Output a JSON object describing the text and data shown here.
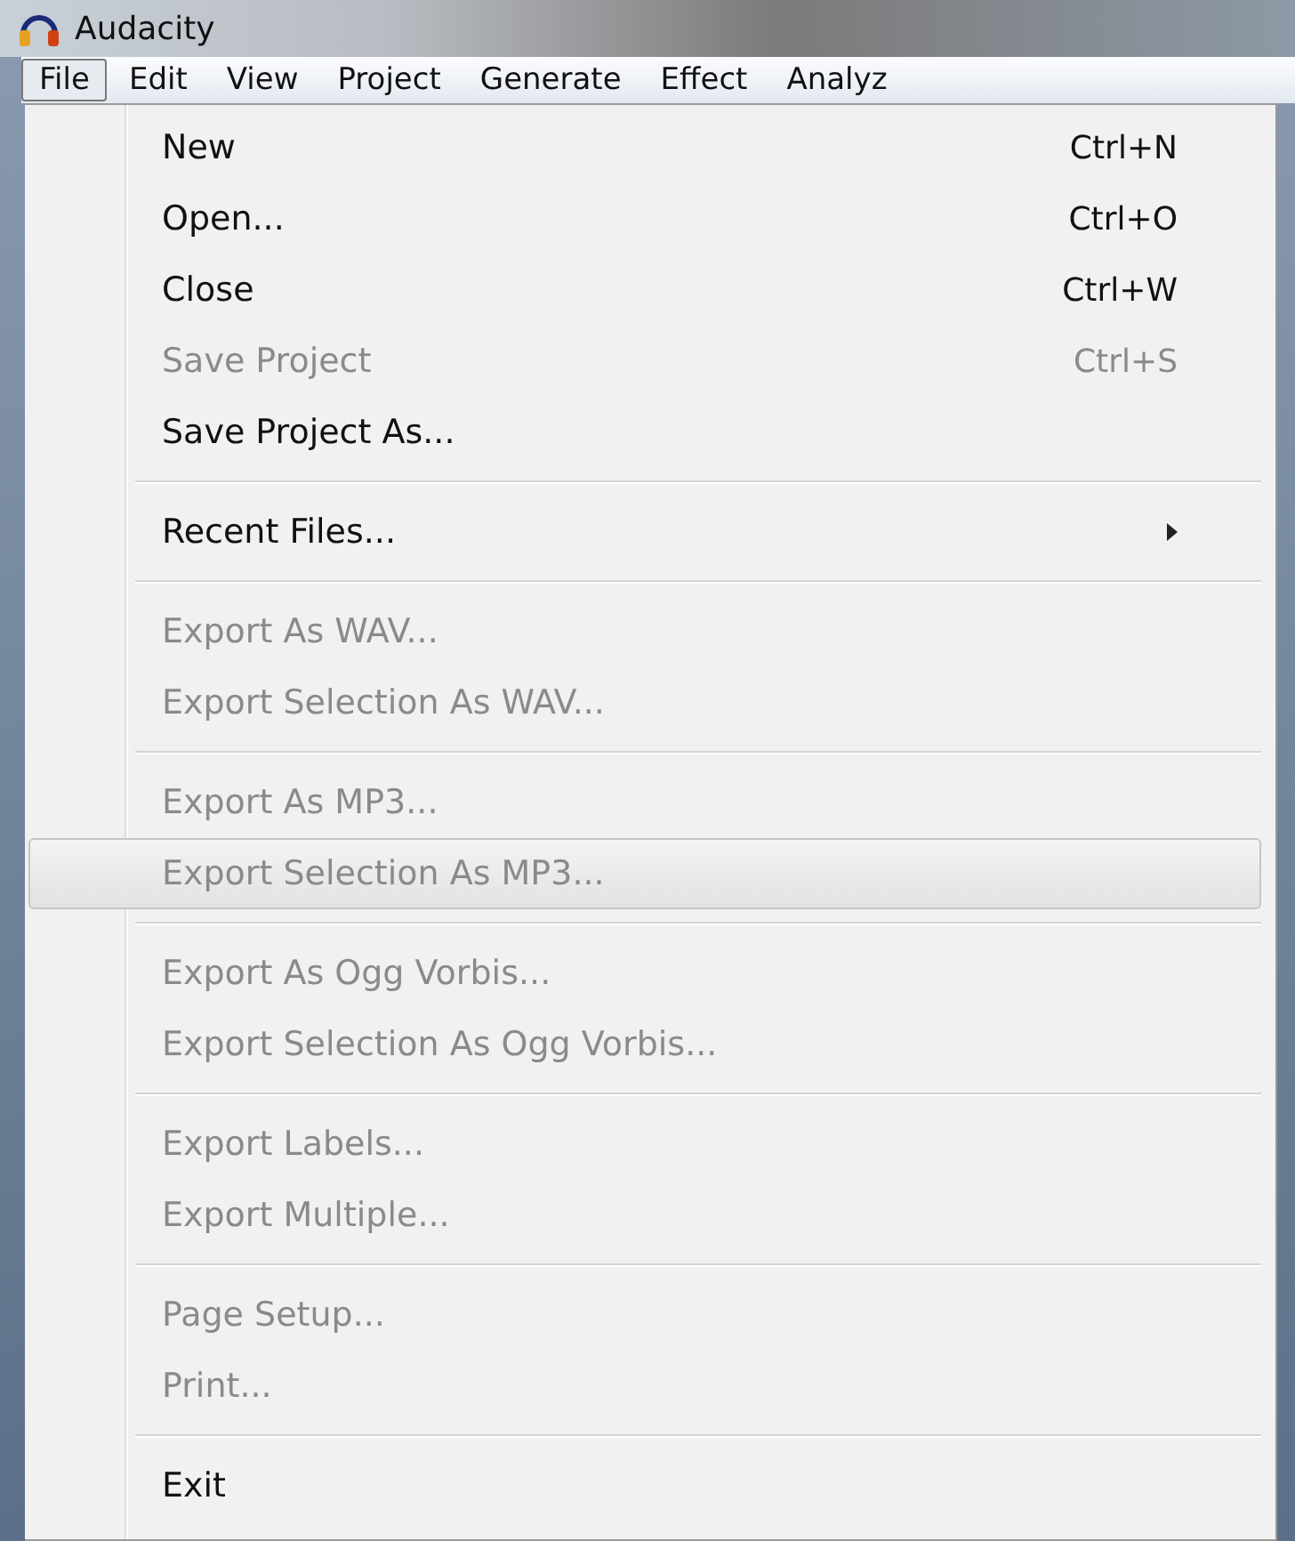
{
  "window": {
    "title": "Audacity"
  },
  "menu_bar": [
    {
      "label": "File",
      "selected": true
    },
    {
      "label": "Edit",
      "selected": false
    },
    {
      "label": "View",
      "selected": false
    },
    {
      "label": "Project",
      "selected": false
    },
    {
      "label": "Generate",
      "selected": false
    },
    {
      "label": "Effect",
      "selected": false
    },
    {
      "label": "Analyz",
      "selected": false
    }
  ],
  "file_menu": [
    {
      "kind": "item",
      "label": "New",
      "shortcut": "Ctrl+N",
      "disabled": false,
      "selected": false
    },
    {
      "kind": "item",
      "label": "Open...",
      "shortcut": "Ctrl+O",
      "disabled": false,
      "selected": false
    },
    {
      "kind": "item",
      "label": "Close",
      "shortcut": "Ctrl+W",
      "disabled": false,
      "selected": false
    },
    {
      "kind": "item",
      "label": "Save Project",
      "shortcut": "Ctrl+S",
      "disabled": true,
      "selected": false
    },
    {
      "kind": "item",
      "label": "Save Project As...",
      "disabled": false,
      "selected": false
    },
    {
      "kind": "separator"
    },
    {
      "kind": "submenu",
      "label": "Recent Files...",
      "disabled": false,
      "selected": false
    },
    {
      "kind": "separator"
    },
    {
      "kind": "item",
      "label": "Export As WAV...",
      "disabled": true,
      "selected": false
    },
    {
      "kind": "item",
      "label": "Export Selection As WAV...",
      "disabled": true,
      "selected": false
    },
    {
      "kind": "separator"
    },
    {
      "kind": "item",
      "label": "Export As MP3...",
      "disabled": true,
      "selected": false
    },
    {
      "kind": "item",
      "label": "Export Selection As MP3...",
      "disabled": true,
      "selected": true
    },
    {
      "kind": "separator"
    },
    {
      "kind": "item",
      "label": "Export As Ogg Vorbis...",
      "disabled": true,
      "selected": false
    },
    {
      "kind": "item",
      "label": "Export Selection As Ogg Vorbis...",
      "disabled": true,
      "selected": false
    },
    {
      "kind": "separator"
    },
    {
      "kind": "item",
      "label": "Export Labels...",
      "disabled": true,
      "selected": false
    },
    {
      "kind": "item",
      "label": "Export Multiple...",
      "disabled": true,
      "selected": false
    },
    {
      "kind": "separator"
    },
    {
      "kind": "item",
      "label": "Page Setup...",
      "disabled": true,
      "selected": false
    },
    {
      "kind": "item",
      "label": "Print...",
      "disabled": true,
      "selected": false
    },
    {
      "kind": "separator"
    },
    {
      "kind": "item",
      "label": "Exit",
      "disabled": false,
      "selected": false
    }
  ]
}
